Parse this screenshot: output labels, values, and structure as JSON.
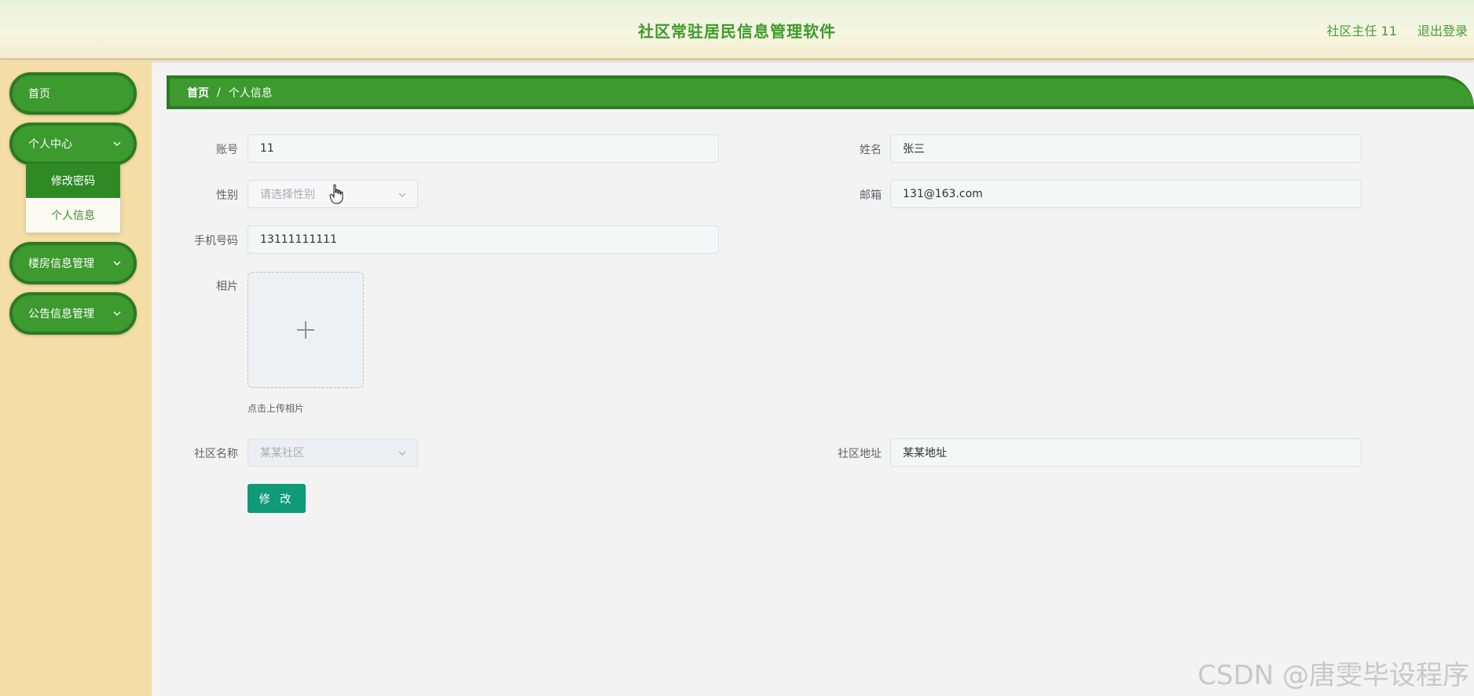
{
  "header": {
    "title": "社区常驻居民信息管理软件",
    "user": "社区主任 11",
    "logout": "退出登录"
  },
  "sidebar": {
    "items": [
      {
        "label": "首页"
      },
      {
        "label": "个人中心"
      },
      {
        "label": "楼房信息管理"
      },
      {
        "label": "公告信息管理"
      }
    ],
    "submenu": [
      {
        "label": "修改密码"
      },
      {
        "label": "个人信息"
      }
    ]
  },
  "breadcrumb": {
    "home": "首页",
    "separator": "/",
    "current": "个人信息"
  },
  "form": {
    "account": {
      "label": "账号",
      "value": "11"
    },
    "name": {
      "label": "姓名",
      "value": "张三"
    },
    "gender": {
      "label": "性别",
      "placeholder": "请选择性别"
    },
    "email": {
      "label": "邮箱",
      "value": "131@163.com"
    },
    "phone": {
      "label": "手机号码",
      "value": "13111111111"
    },
    "photo": {
      "label": "相片",
      "hint": "点击上传相片"
    },
    "community_name": {
      "label": "社区名称",
      "placeholder": "某某社区"
    },
    "community_address": {
      "label": "社区地址",
      "value": "某某地址"
    },
    "submit": "修 改"
  },
  "watermark": "CSDN @唐雯毕设程序",
  "colors": {
    "primary_green": "#3c9a2e",
    "dark_green": "#2b7a22",
    "sidebar_bg": "#f4dea6",
    "button_teal": "#0f9a78"
  },
  "icons": [
    "chevron-down-icon",
    "plus-icon",
    "hand-cursor-icon"
  ]
}
